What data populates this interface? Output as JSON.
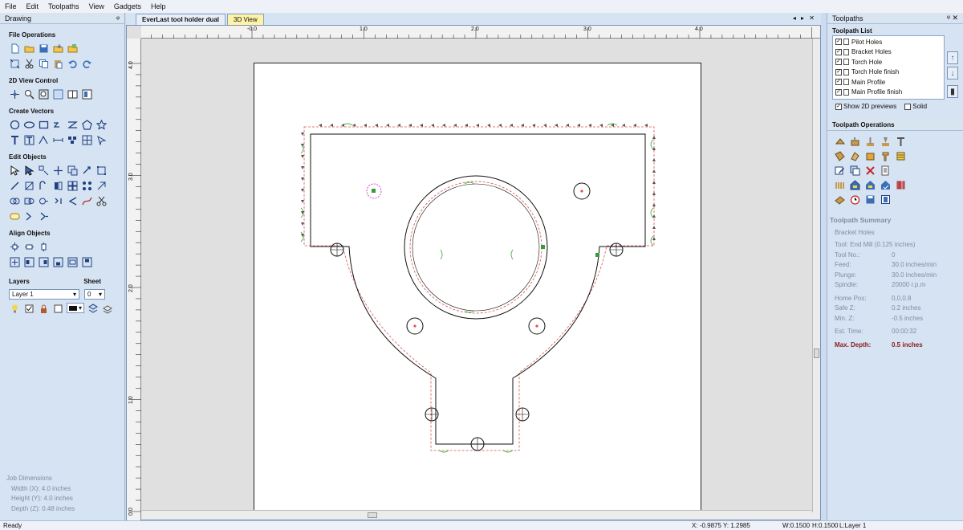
{
  "menu": [
    "File",
    "Edit",
    "Toolpaths",
    "View",
    "Gadgets",
    "Help"
  ],
  "left_panel": {
    "title": "Drawing",
    "pin": "ᵠ",
    "sections": {
      "file_ops": "File Operations",
      "view_2d": "2D View Control",
      "create_vectors": "Create Vectors",
      "edit_objects": "Edit Objects",
      "align_objects": "Align Objects"
    },
    "layers": {
      "label": "Layers",
      "sheet_label": "Sheet",
      "layer_value": "Layer 1",
      "sheet_value": "0"
    },
    "job_dimensions": {
      "title": "Job Dimensions",
      "width": "Width  (X): 4.0 inches",
      "height": "Height (Y): 4.0 inches",
      "depth": "Depth  (Z): 0.48 inches"
    }
  },
  "tabs": {
    "active": "EverLast tool holder dual",
    "second": "3D View",
    "controls": "◂ ▸ ✕"
  },
  "ruler": {
    "h_ticks": [
      "-0.0",
      "1.0",
      "2.0",
      "3.0",
      "4.0"
    ],
    "v_ticks": [
      "4.0",
      "3.0",
      "2.0",
      "1.0",
      "0.0"
    ]
  },
  "right_panel": {
    "title": "Toolpaths",
    "pin": "ᵠ ✕",
    "list_title": "Toolpath List",
    "items": [
      "Pilot Holes",
      "Bracket Holes",
      "Torch Hole",
      "Torch Hole finish",
      "Main Profile",
      "Main Profile finish"
    ],
    "show_2d": "Show 2D previews",
    "solid": "Solid",
    "ops_title": "Toolpath Operations",
    "summary": {
      "title": "Toolpath Summary",
      "name": "Bracket Holes",
      "tool": "Tool: End Mill (0.125 inches)",
      "rows": [
        {
          "k": "Tool No.:",
          "v": "0"
        },
        {
          "k": "Feed:",
          "v": "30.0 inches/min"
        },
        {
          "k": "Plunge:",
          "v": "30.0 inches/min"
        },
        {
          "k": "Spindle:",
          "v": "20000 r.p.m"
        }
      ],
      "rows2": [
        {
          "k": "Home Pos:",
          "v": "0,0,0.8"
        },
        {
          "k": "Safe Z:",
          "v": "0.2 inches"
        },
        {
          "k": "Min. Z:",
          "v": "-0.5 inches"
        }
      ],
      "est_time_k": "Est. Time:",
      "est_time_v": "00:00:32",
      "max_depth_k": "Max. Depth:",
      "max_depth_v": "0.5 inches"
    }
  },
  "status": {
    "ready": "Ready",
    "xy": "X: -0.9875 Y:  1.2985",
    "w": "W:0.1500",
    "h": "H:0.1500",
    "layer": "L:Layer 1"
  },
  "colors": {
    "panel": "#d6e3f2",
    "toolpath": "#d9534f",
    "tab_marker": "#4caf50",
    "active_tab": "#e8eef7",
    "alt_tab": "#fdf2a6"
  }
}
